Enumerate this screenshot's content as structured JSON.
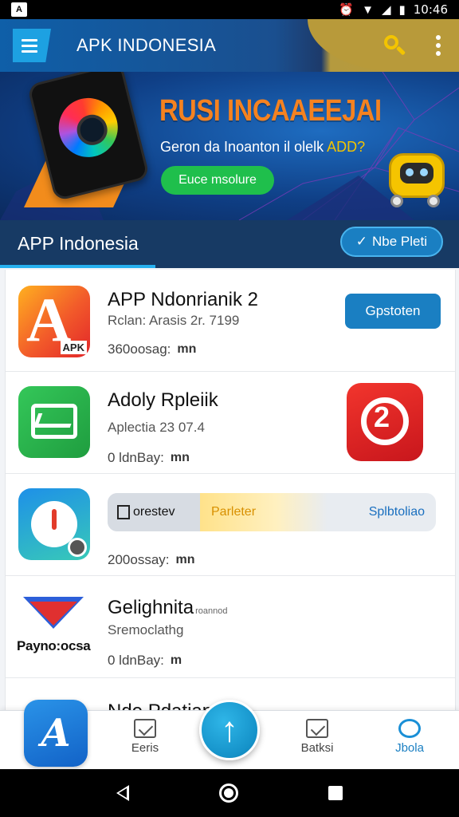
{
  "status_bar": {
    "time": "10:46"
  },
  "app_bar": {
    "title": "APK INDONESIA"
  },
  "banner": {
    "headline": "RUSI INCAAEEJAI",
    "subtitle_main": "Geron da Inoanton il olelk ",
    "subtitle_highlight": "ADD?",
    "cta_label": "Euce msolure"
  },
  "section": {
    "title": "APP Indonesia",
    "action_label": "Nbe Pleti",
    "action_icon": "check-icon"
  },
  "apps": [
    {
      "name": "APP Ndonrianik  2",
      "meta": "Rclan: Arasis 2r. 7199",
      "stat": "360oosag:",
      "stat_icon": "mn",
      "button": "Gpstoten",
      "icon_tag": "APK"
    },
    {
      "name": "Adoly Rpleiik",
      "meta": "Aplectia 23 07.4",
      "stat": "0 ldnBay:",
      "stat_icon": "mn"
    },
    {
      "name": "",
      "progress": {
        "left_label": "orestev",
        "mid_label": "Parleter",
        "right_label": "Splbtoliao"
      },
      "stat": "200ossay:",
      "stat_icon": "mn"
    },
    {
      "name": "Gelighnita",
      "name_suffix": "roannod",
      "meta": "Sremoclathg",
      "stat": "0 ldnBay:",
      "stat_icon": "m",
      "icon_label": "Payno:ocsa"
    },
    {
      "name": "Nde Pdatian"
    }
  ],
  "bottom_nav": {
    "items": [
      {
        "label": "Eeris",
        "icon": "edit-icon"
      },
      {
        "label": "Batksi",
        "icon": "chart-icon"
      },
      {
        "label": "Jbola",
        "icon": "circle-icon",
        "active": true
      }
    ],
    "fab_icon": "arrow-up-icon"
  }
}
